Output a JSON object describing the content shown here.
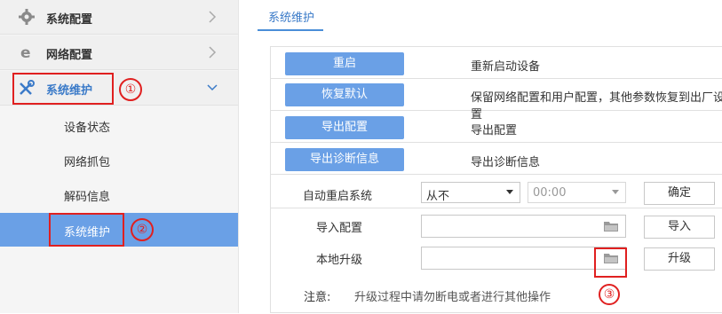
{
  "sidebar": {
    "nav": [
      {
        "label": "系统配置",
        "icon": "gear-icon"
      },
      {
        "label": "网络配置",
        "icon": "network-e-icon"
      },
      {
        "label": "系统维护",
        "icon": "tools-icon"
      }
    ],
    "subitems": [
      {
        "label": "设备状态"
      },
      {
        "label": "网络抓包"
      },
      {
        "label": "解码信息"
      },
      {
        "label": "系统维护",
        "active": true
      }
    ]
  },
  "main": {
    "tab": "系统维护",
    "actions": [
      {
        "button": "重启",
        "description": "重新启动设备"
      },
      {
        "button": "恢复默认",
        "description": "保留网络配置和用户配置，其他参数恢复到出厂设置"
      },
      {
        "button": "导出配置",
        "description": "导出配置"
      },
      {
        "button": "导出诊断信息",
        "description": "导出诊断信息"
      }
    ],
    "auto_reboot": {
      "label": "自动重启系统",
      "mode": "从不",
      "time": "00:00",
      "confirm": "确定"
    },
    "import_config": {
      "label": "导入配置",
      "value": "",
      "button": "导入"
    },
    "local_upgrade": {
      "label": "本地升级",
      "value": "",
      "button": "升级"
    },
    "note": {
      "label": "注意:",
      "text": "升级过程中请勿断电或者进行其他操作"
    }
  },
  "annotations": {
    "step1": "①",
    "step2": "②",
    "step3": "③"
  },
  "colors": {
    "accent": "#6aa0e6",
    "highlight": "#e02020",
    "tab": "#3a7ac8"
  }
}
